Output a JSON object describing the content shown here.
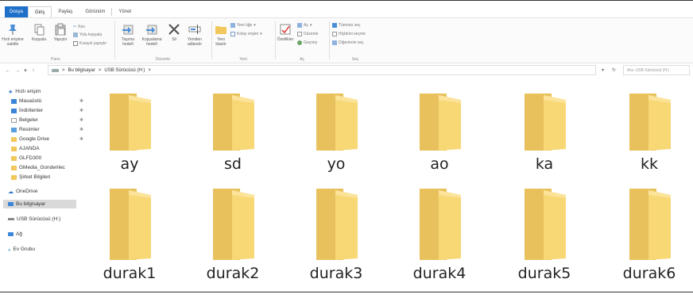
{
  "ribbon_tabs": [
    "Dosya",
    "Giriş",
    "Paylaş",
    "Görünüm",
    "Yönet"
  ],
  "ribbon": {
    "pano": {
      "label": "Pano",
      "pin_label": "Hızlı erişime sabitle",
      "copy_label": "Kopyala",
      "paste_label": "Yapıştır",
      "cut_label": "Kes",
      "copy_path_label": "Yolu kopyala",
      "paste_shortcut_label": "Kısayol yapıştır"
    },
    "duzenle": {
      "label": "Düzenle",
      "move_label": "Taşıma hedefi",
      "copy_to_label": "Kopyalama hedefi",
      "delete_label": "Sil",
      "rename_label": "Yeniden adlandır"
    },
    "yeni": {
      "label": "Yeni",
      "new_folder_label": "Yeni klasör",
      "new_item_label": "Yeni öğe",
      "easy_access_label": "Kolay erişim"
    },
    "ac": {
      "label": "Aç",
      "properties_label": "Özellikler",
      "open_label": "Aç",
      "edit_label": "Düzenle",
      "history_label": "Geçmiş"
    },
    "sec": {
      "label": "Seç",
      "select_all_label": "Tümünü seç",
      "select_none_label": "Hiçbirini seçme",
      "invert_label": "Diğerlerini seç"
    }
  },
  "address": {
    "crumbs": [
      "Bu bilgisayar",
      "USB Sürücüsü (H:)"
    ],
    "separator": ">",
    "search_placeholder": "Ara: USB Sürücüsü (H:)"
  },
  "nav": {
    "quick_access": "Hızlı erişim",
    "items": [
      {
        "label": "Masaüstü",
        "pinned": true
      },
      {
        "label": "İndirilenler",
        "pinned": true
      },
      {
        "label": "Belgeler",
        "pinned": true
      },
      {
        "label": "Resimler",
        "pinned": true
      },
      {
        "label": "Google Drive",
        "pinned": true
      },
      {
        "label": "AJANDA",
        "pinned": false
      },
      {
        "label": "GLFD300",
        "pinned": false
      },
      {
        "label": "GMedia_Gonderilec",
        "pinned": false
      },
      {
        "label": "Şirket Bilgileri",
        "pinned": false
      }
    ],
    "onedrive": "OneDrive",
    "this_pc": "Bu bilgisayar",
    "usb": "USB Sürücüsü (H:)",
    "network": "Ağ",
    "homegroup": "Ev Grubu"
  },
  "folders": [
    "ay",
    "sd",
    "yo",
    "ao",
    "ka",
    "kk",
    "durak1",
    "durak2",
    "durak3",
    "durak4",
    "durak5",
    "durak6"
  ],
  "colors": {
    "file_tab": "#1e6fc9",
    "folder_back": "#e8c15d",
    "folder_front": "#f8d775",
    "selection": "#d9d9d9"
  }
}
